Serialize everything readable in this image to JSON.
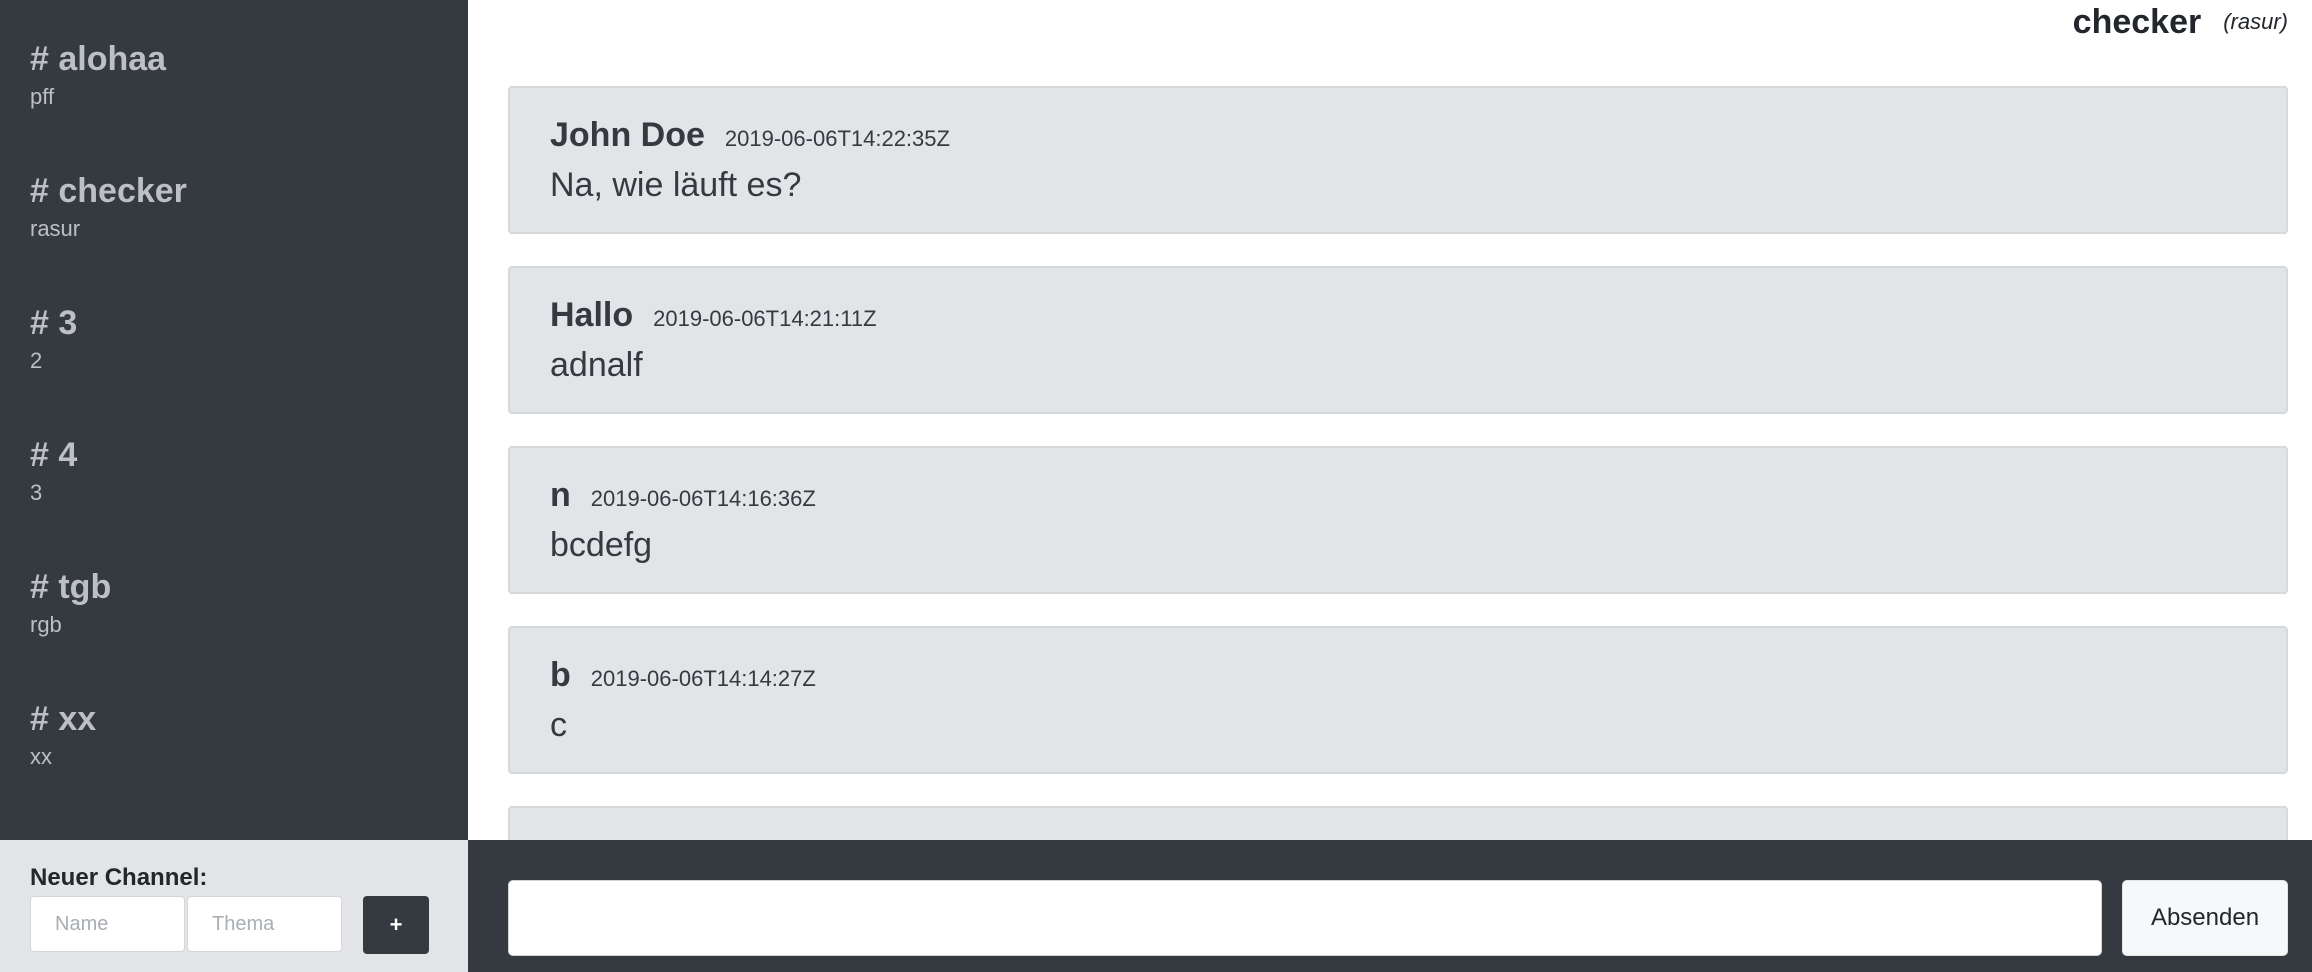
{
  "sidebar": {
    "channels": [
      {
        "name": "# alohaa",
        "topic": "pff"
      },
      {
        "name": "# checker",
        "topic": "rasur"
      },
      {
        "name": "# 3",
        "topic": "2"
      },
      {
        "name": "# 4",
        "topic": "3"
      },
      {
        "name": "# tgb",
        "topic": "rgb"
      },
      {
        "name": "# xx",
        "topic": "xx"
      }
    ]
  },
  "new_channel": {
    "label": "Neuer Channel:",
    "name_placeholder": "Name",
    "topic_placeholder": "Thema",
    "add_label": "+"
  },
  "header": {
    "title": "checker",
    "topic": "(rasur)"
  },
  "messages": [
    {
      "author": "John Doe",
      "time": "2019-06-06T14:22:35Z",
      "text": "Na, wie läuft es?"
    },
    {
      "author": "Hallo",
      "time": "2019-06-06T14:21:11Z",
      "text": "adnalf"
    },
    {
      "author": "n",
      "time": "2019-06-06T14:16:36Z",
      "text": "bcdefg"
    },
    {
      "author": "b",
      "time": "2019-06-06T14:14:27Z",
      "text": "c"
    },
    {
      "author": "",
      "time": "",
      "text": ""
    }
  ],
  "compose": {
    "value": "",
    "send_label": "Absenden"
  },
  "colors": {
    "sidebar_bg": "#343a40",
    "message_bg": "#e2e4e7",
    "channel_text": "#bcc0c4"
  }
}
